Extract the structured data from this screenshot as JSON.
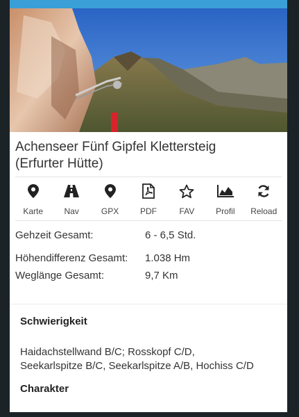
{
  "title": [
    "Achenseer Fünf Gipfel Klettersteig",
    "(Erfurter Hütte)"
  ],
  "actions": [
    {
      "label": "Karte",
      "icon": "location-pin-icon"
    },
    {
      "label": "Nav",
      "icon": "road-icon"
    },
    {
      "label": "GPX",
      "icon": "location-pin-icon"
    },
    {
      "label": "PDF",
      "icon": "pdf-file-icon"
    },
    {
      "label": "FAV",
      "icon": "star-icon"
    },
    {
      "label": "Profil",
      "icon": "area-chart-icon"
    },
    {
      "label": "Reload",
      "icon": "refresh-icon"
    }
  ],
  "facts": [
    {
      "key": "Gehzeit Gesamt:",
      "value": "6 - 6,5 Std."
    },
    {
      "key": "Höhendifferenz Gesamt:",
      "value": "1.038 Hm"
    },
    {
      "key": "Weglänge Gesamt:",
      "value": "9,7 Km"
    }
  ],
  "difficulty": {
    "heading": "Schwierigkeit",
    "text": [
      "Haidachstellwand B/C; Rosskopf C/D,",
      "Seekarlspitze B/C, Seekarlspitze A/B, Hochiss C/D"
    ]
  },
  "character": {
    "heading": "Charakter"
  },
  "colors": {
    "accent": "#3a9fd6",
    "sky": "#2f6fc9"
  }
}
